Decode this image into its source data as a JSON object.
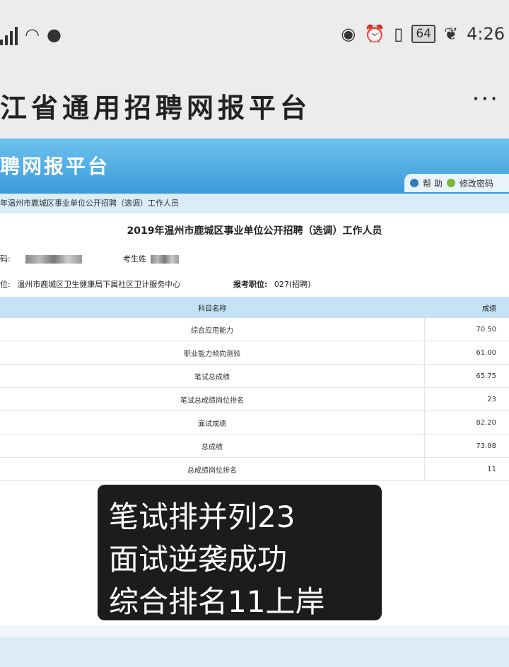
{
  "status_bar": {
    "battery": "64",
    "time": "4:26"
  },
  "app_bar": {
    "title": "江省通用招聘网报平台",
    "more": "···"
  },
  "site": {
    "header_title": "聘网报平台",
    "help_label": "帮 助",
    "change_password_label": "修改密码",
    "breadcrumb": "年温州市鹿城区事业单位公开招聘（选调）工作人员"
  },
  "exam": {
    "title": "2019年温州市鹿城区事业单位公开招聘（选调）工作人员",
    "id_label": "码:",
    "name_label": "考生姓",
    "unit_label": "位:",
    "unit_value": "温州市鹿城区卫生健康局下属社区卫计服务中心",
    "position_label": "报考职位:",
    "position_value": "027(招聘)"
  },
  "table": {
    "headers": [
      "科目名称",
      "成绩"
    ],
    "rows": [
      {
        "subject": "综合应用能力",
        "score": "70.50"
      },
      {
        "subject": "职业能力倾向测验",
        "score": "61.00"
      },
      {
        "subject": "笔试总成绩",
        "score": "65.75"
      },
      {
        "subject": "笔试总成绩岗位排名",
        "score": "23"
      },
      {
        "subject": "面试成绩",
        "score": "82.20"
      },
      {
        "subject": "总成绩",
        "score": "73.98"
      },
      {
        "subject": "总成绩岗位排名",
        "score": "11"
      }
    ]
  },
  "caption": {
    "line1": "笔试排并列23",
    "line2": "面试逆袭成功",
    "line3": "综合排名11上岸"
  }
}
